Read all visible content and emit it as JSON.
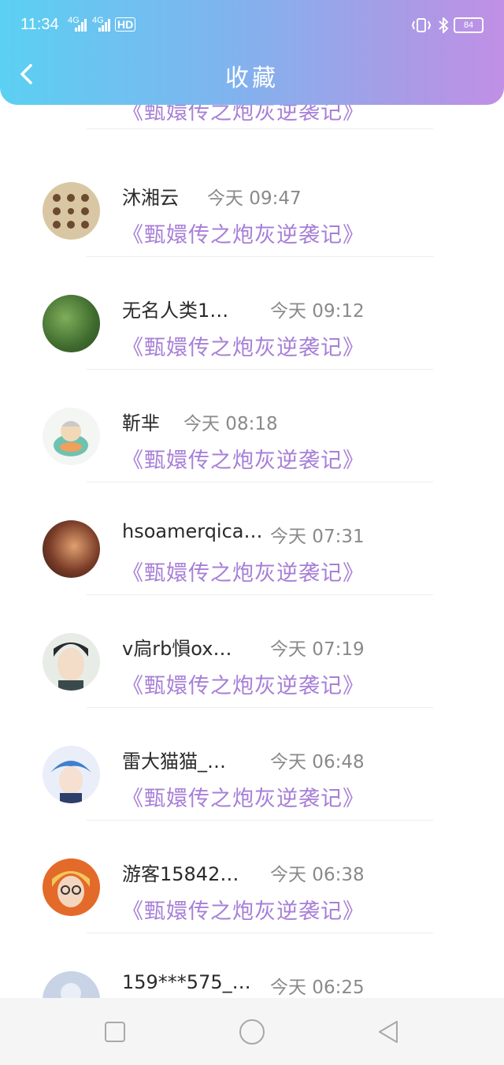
{
  "status_bar": {
    "time": "11:34",
    "network1": "4G",
    "network2": "4G",
    "hd": "HD",
    "battery": "84"
  },
  "header": {
    "title": "收藏"
  },
  "items": [
    {
      "name": "",
      "time": "",
      "book": "《甄嬛传之炮灰逆袭记》",
      "avatar": "partial"
    },
    {
      "name": "沐湘云",
      "time": "今天 09:47",
      "book": "《甄嬛传之炮灰逆袭记》",
      "avatar": "bears"
    },
    {
      "name": "无名人类1…",
      "time": "今天 09:12",
      "book": "《甄嬛传之炮灰逆袭记》",
      "avatar": "plant"
    },
    {
      "name": "靳芈",
      "time": "今天 08:18",
      "book": "《甄嬛传之炮灰逆袭记》",
      "avatar": "cartoon"
    },
    {
      "name": "hsoamerqica…",
      "time": "今天 07:31",
      "book": "《甄嬛传之炮灰逆袭记》",
      "avatar": "photo"
    },
    {
      "name": "v扃rb愪ox…",
      "time": "今天 07:19",
      "book": "《甄嬛传之炮灰逆袭记》",
      "avatar": "man"
    },
    {
      "name": "雷大猫猫_…",
      "time": "今天 06:48",
      "book": "《甄嬛传之炮灰逆袭记》",
      "avatar": "anime"
    },
    {
      "name": "游客15842…",
      "time": "今天 06:38",
      "book": "《甄嬛传之炮灰逆袭记》",
      "avatar": "glasses"
    },
    {
      "name": "159***575_…",
      "time": "今天 06:25",
      "book": "",
      "avatar": "default"
    }
  ],
  "nav": {
    "recent": "square-icon",
    "home": "circle-icon",
    "back": "triangle-icon"
  }
}
